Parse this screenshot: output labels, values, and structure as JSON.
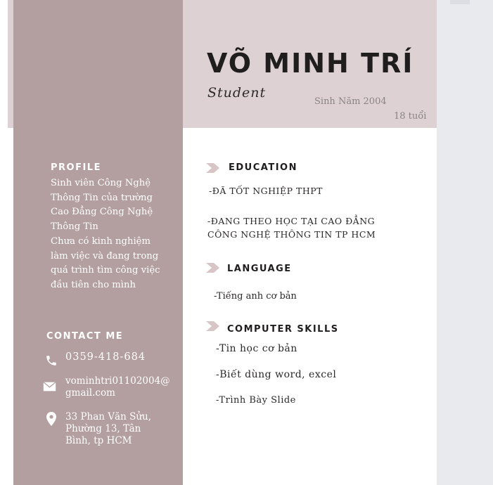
{
  "header": {
    "name": "VÕ MINH TRÍ",
    "role": "Student",
    "birth_year": "Sinh Năm 2004",
    "age": "18 tuổi"
  },
  "sidebar": {
    "profile_heading": "PROFILE",
    "profile_lines": [
      "Sinh viên Công Nghệ",
      "Thông Tin của trường",
      "Cao Đẳng Công Nghệ",
      "Thông Tin",
      "Chưa có kinh nghiệm",
      "làm việc và đang trong",
      "quá trình tìm công việc",
      "đầu tiên cho mình"
    ],
    "contact_heading": "CONTACT ME",
    "contacts": {
      "phone": "0359-418-684",
      "email_line1": "vominhtri01102004@",
      "email_line2": "gmail.com",
      "address_lines": [
        "33 Phan Văn Sửu,",
        "Phường 13, Tân",
        "Bình, tp HCM"
      ]
    },
    "icons": [
      "phone-icon",
      "mail-icon",
      "location-pin-icon"
    ]
  },
  "main": {
    "education": {
      "heading": "EDUCATION",
      "item1": "-ĐÃ TỐT NGHIỆP THPT",
      "item2_line1": "-ĐANG THEO HỌC TẠI CAO ĐẲNG",
      "item2_line2": "CÔNG NGHỆ THÔNG TIN TP HCM"
    },
    "language": {
      "heading": "LANGUAGE",
      "item1": "-Tiếng anh cơ bản"
    },
    "computer_skills": {
      "heading": "COMPUTER SKILLS",
      "items": [
        "-Tin học cơ bản",
        "-Biết dùng word, excel",
        "-Trình Bày Slide"
      ]
    }
  },
  "colors": {
    "header_band": "#ddd1d3",
    "sidebar": "#b39fa0",
    "arrow": "#d8c5c8",
    "right_gutter": "#e9eaee"
  }
}
